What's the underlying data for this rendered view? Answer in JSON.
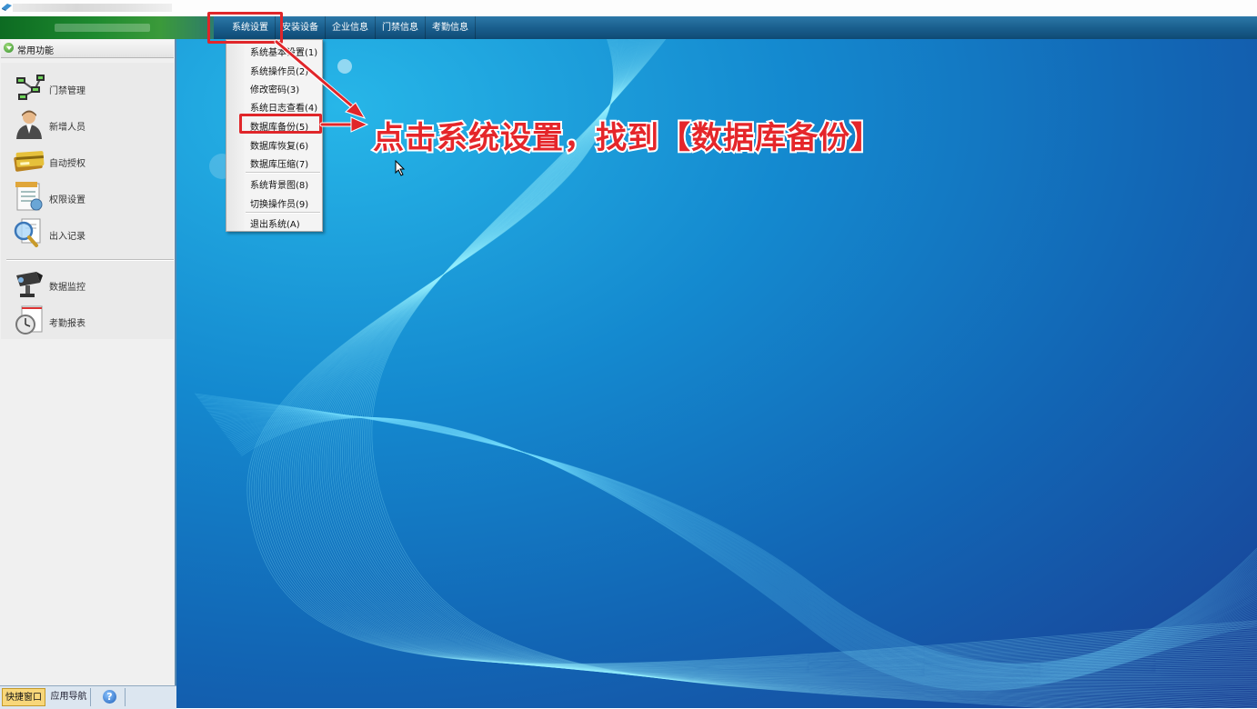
{
  "menubar": {
    "items": [
      {
        "label": "系统设置"
      },
      {
        "label": "安装设备"
      },
      {
        "label": "企业信息"
      },
      {
        "label": "门禁信息"
      },
      {
        "label": "考勤信息"
      }
    ]
  },
  "dropdown": {
    "items": [
      {
        "label": "系统基本设置(1)"
      },
      {
        "label": "系统操作员(2)"
      },
      {
        "label": "修改密码(3)"
      },
      {
        "label": "系统日志查看(4)"
      },
      {
        "label": "数据库备份(5)"
      },
      {
        "label": "数据库恢复(6)"
      },
      {
        "label": "数据库压缩(7)"
      },
      {
        "label": "系统背景图(8)"
      },
      {
        "label": "切换操作员(9)"
      },
      {
        "label": "退出系统(A)"
      }
    ]
  },
  "sidebar": {
    "title": "常用功能",
    "items": [
      {
        "label": "门禁管理",
        "icon": "network-icon"
      },
      {
        "label": "新增人员",
        "icon": "person-icon"
      },
      {
        "label": "自动授权",
        "icon": "card-icon"
      },
      {
        "label": "权限设置",
        "icon": "document-icon"
      },
      {
        "label": "出入记录",
        "icon": "magnifier-icon"
      },
      {
        "label": "数据监控",
        "icon": "camera-icon"
      },
      {
        "label": "考勤报表",
        "icon": "clock-icon"
      }
    ],
    "tabs": [
      {
        "label": "快捷窗口"
      },
      {
        "label": "应用导航"
      },
      {
        "label": "?"
      }
    ]
  },
  "annotation": {
    "text": "点击系统设置，找到【数据库备份】",
    "color": "#e0262a"
  },
  "colors": {
    "menubar": "#1a5f8e",
    "desktop": "#1489cf",
    "highlight": "#e0262a"
  }
}
